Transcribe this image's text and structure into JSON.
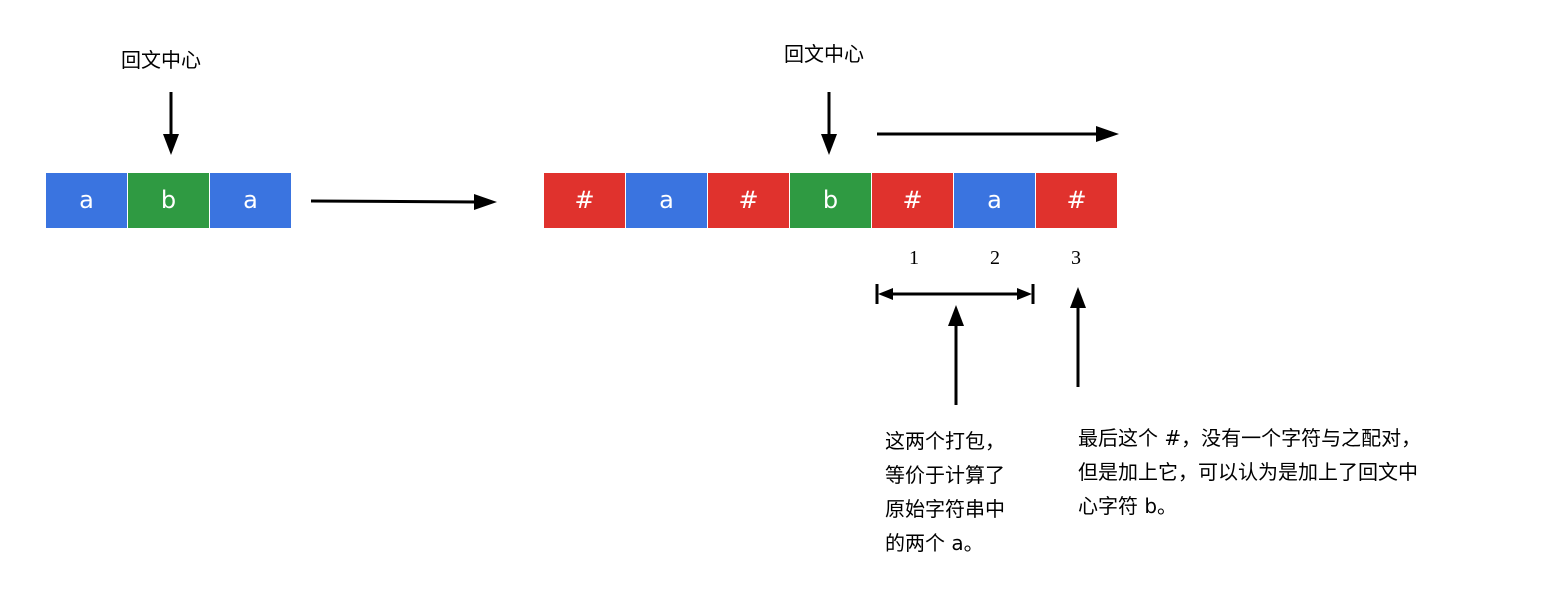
{
  "colors": {
    "blue": "#3a74e0",
    "green": "#2f9a42",
    "red": "#e0322d",
    "arrow": "#000000"
  },
  "left": {
    "center_label": "回文中心",
    "cells": [
      {
        "text": "a",
        "color": "blue"
      },
      {
        "text": "b",
        "color": "green"
      },
      {
        "text": "a",
        "color": "blue"
      }
    ]
  },
  "right": {
    "center_label": "回文中心",
    "cells": [
      {
        "text": "#",
        "color": "red"
      },
      {
        "text": "a",
        "color": "blue"
      },
      {
        "text": "#",
        "color": "red"
      },
      {
        "text": "b",
        "color": "green"
      },
      {
        "text": "#",
        "color": "red"
      },
      {
        "text": "a",
        "color": "blue"
      },
      {
        "text": "#",
        "color": "red"
      }
    ],
    "indices": [
      "1",
      "2",
      "3"
    ]
  },
  "notes": {
    "pair": [
      "这两个打包，",
      "等价于计算了",
      "原始字符串中",
      "的两个 a。"
    ],
    "last": [
      "最后这个 #，没有一个字符与之配对，",
      "但是加上它，可以认为是加上了回文中",
      "心字符 b。"
    ]
  }
}
